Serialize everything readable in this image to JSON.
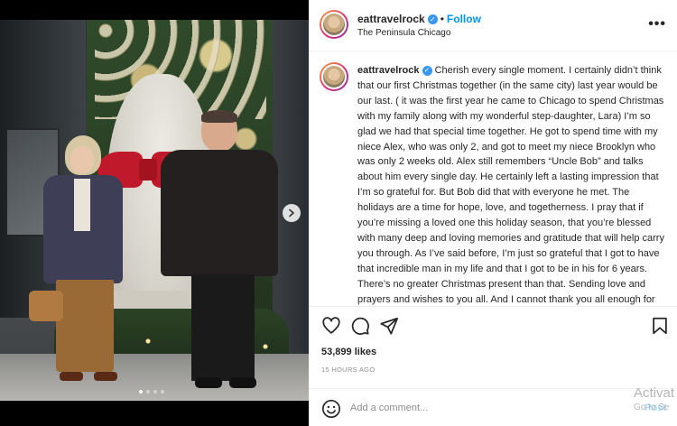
{
  "post": {
    "username": "eattravelrock",
    "verified": true,
    "follow_label": "Follow",
    "location": "The Peninsula Chicago",
    "more_label": "•••",
    "caption": "Cherish every single moment. I certainly didn’t think that our first Christmas together (in the same city) last year would be our last. ( it was the first year he came to Chicago to spend Christmas with my family along with my wonderful step-daughter, Lara) I’m so glad we had that special time together. He got to spend time with my niece Alex, who was only 2, and got to meet my niece Brooklyn who was only 2 weeks old. Alex still remembers “Uncle Bob” and talks about him every single day. He certainly left a lasting impression that I’m so grateful for. But Bob did that with everyone he met. The holidays are a time for hope, love, and togetherness. I pray that if you’re missing a loved one this holiday season, that you’re blessed with many deep and loving memories and gratitude that will help carry you through. As I’ve said before, I’m just so grateful that I got to have that incredible man in my life and that I got to be in his for 6 years. There’s no greater Christmas present than that. Sending love and prayers and wishes to you all. And I cannot thank you all enough for almost a full year of all the love and support and kindness",
    "likes": "53,899 likes",
    "timestamp": "15 HOURS AGO"
  },
  "carousel": {
    "slide_count": 4,
    "active_index": 0
  },
  "comment": {
    "placeholder": "Add a comment...",
    "post_label": "Post"
  },
  "watermark": {
    "line1": "Activat",
    "line2": "Go to Se"
  },
  "colors": {
    "accent": "#0095f6",
    "verified": "#3897f0",
    "bow": "#c0192b"
  },
  "icons": [
    "verified-badge-icon",
    "more-options-icon",
    "heart-icon",
    "comment-icon",
    "share-icon",
    "save-bookmark-icon",
    "emoji-icon",
    "chevron-right-icon"
  ]
}
